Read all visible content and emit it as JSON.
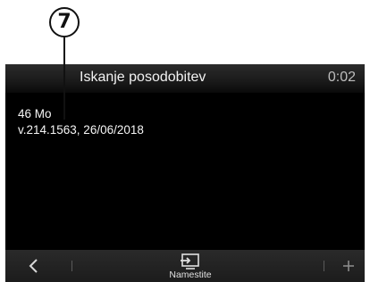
{
  "callout": {
    "number": "7"
  },
  "screen": {
    "header": {
      "title": "Iskanje posodobitev",
      "clock": "0:02"
    },
    "content": {
      "size": "46 Mo",
      "version": "v.214.1563, 26/06/2018"
    },
    "footer": {
      "install_label": "Namestite",
      "icons": [
        "back-arrow-icon",
        "install-screen-icon",
        "plus-icon"
      ]
    }
  },
  "colors": {
    "background": "#000000",
    "text": "#f5f5f5",
    "clock": "#bdbdbd"
  }
}
